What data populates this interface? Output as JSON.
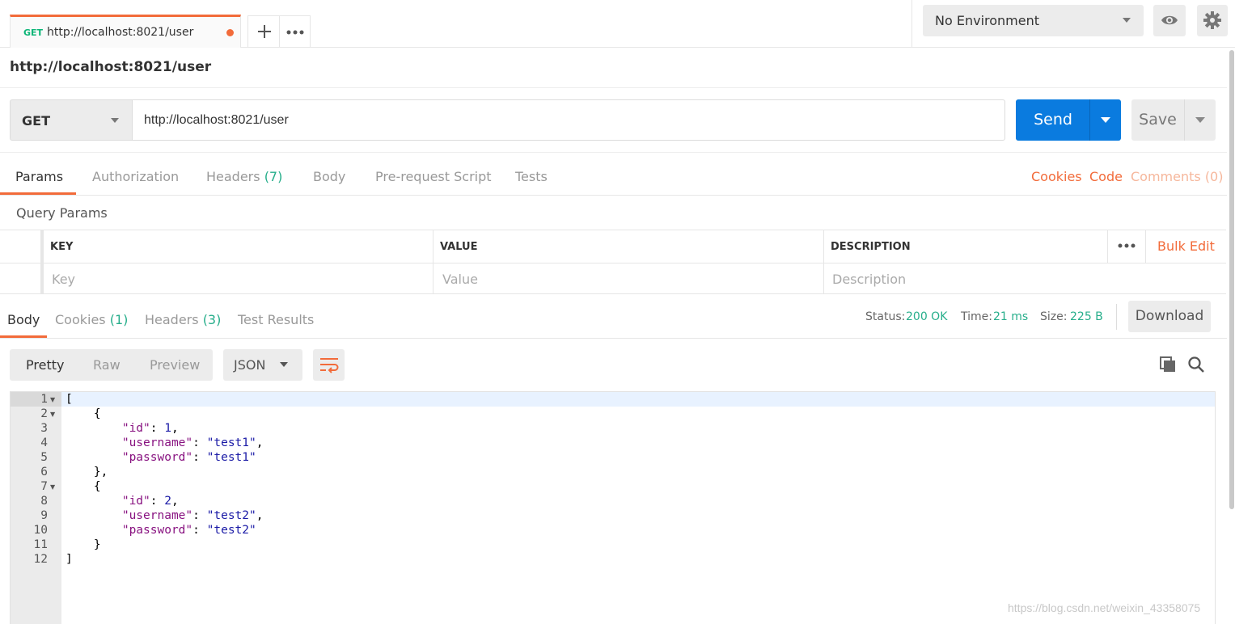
{
  "tabs": [
    {
      "method": "GET",
      "url": "http://localhost:8021/user",
      "unsaved": true
    }
  ],
  "tabbar": {
    "new_tab_icon": "plus-icon",
    "menu_icon": "more-horizontal-icon"
  },
  "environment": {
    "selected": "No Environment"
  },
  "request": {
    "name": "http://localhost:8021/user",
    "method": "GET",
    "url": "http://localhost:8021/user",
    "send_label": "Send",
    "save_label": "Save"
  },
  "request_tabs": {
    "params": "Params",
    "authorization": "Authorization",
    "headers": "Headers",
    "headers_count": "(7)",
    "body": "Body",
    "prerequest": "Pre-request Script",
    "tests": "Tests",
    "active": "Params"
  },
  "request_links": {
    "cookies": "Cookies",
    "code": "Code",
    "comments": "Comments (0)"
  },
  "query_params": {
    "title": "Query Params",
    "columns": {
      "key": "KEY",
      "value": "VALUE",
      "description": "DESCRIPTION"
    },
    "placeholders": {
      "key": "Key",
      "value": "Value",
      "description": "Description"
    },
    "bulk_edit": "Bulk Edit"
  },
  "response_tabs": {
    "body": "Body",
    "cookies": "Cookies",
    "cookies_count": "(1)",
    "headers": "Headers",
    "headers_count": "(3)",
    "test_results": "Test Results",
    "active": "Body"
  },
  "response_meta": {
    "status_label": "Status:",
    "status_value": "200 OK",
    "time_label": "Time:",
    "time_value": "21 ms",
    "size_label": "Size:",
    "size_value": "225 B",
    "download_label": "Download"
  },
  "view": {
    "modes": [
      "Pretty",
      "Raw",
      "Preview"
    ],
    "active_mode": "Pretty",
    "format": "JSON"
  },
  "code_lines": [
    {
      "n": "1",
      "text": "["
    },
    {
      "n": "2",
      "text": "    {"
    },
    {
      "n": "3",
      "key": "\"id\"",
      "sep": ": ",
      "val": "1",
      "tail": ","
    },
    {
      "n": "4",
      "key": "\"username\"",
      "sep": ": ",
      "val": "\"test1\"",
      "tail": ","
    },
    {
      "n": "5",
      "key": "\"password\"",
      "sep": ": ",
      "val": "\"test1\"",
      "tail": ""
    },
    {
      "n": "6",
      "text": "    },"
    },
    {
      "n": "7",
      "text": "    {"
    },
    {
      "n": "8",
      "key": "\"id\"",
      "sep": ": ",
      "val": "2",
      "tail": ","
    },
    {
      "n": "9",
      "key": "\"username\"",
      "sep": ": ",
      "val": "\"test2\"",
      "tail": ","
    },
    {
      "n": "10",
      "key": "\"password\"",
      "sep": ": ",
      "val": "\"test2\"",
      "tail": ""
    },
    {
      "n": "11",
      "text": "    }"
    },
    {
      "n": "12",
      "text": "]"
    }
  ],
  "watermark": "https://blog.csdn.net/weixin_43358075",
  "colors": {
    "accent": "#f26b3a",
    "primary": "#0a7bdf",
    "success": "#27ae8b",
    "get_method": "#0cb577"
  }
}
